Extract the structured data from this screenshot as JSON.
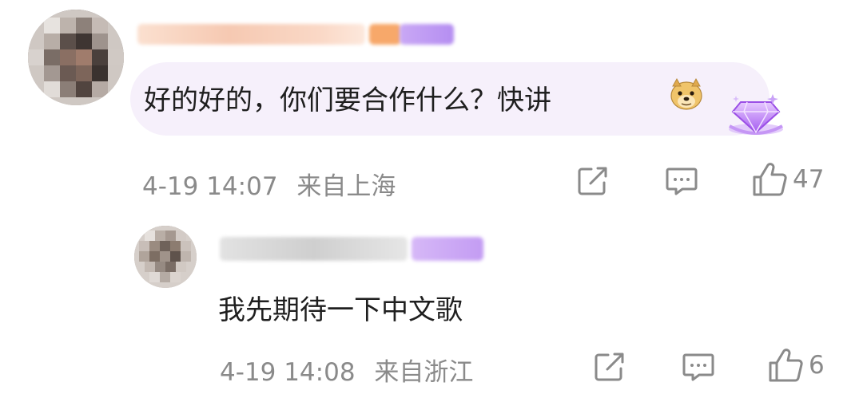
{
  "comments": [
    {
      "text": "好的好的，你们要合作什么？快讲",
      "emoji": "doge-emoji",
      "badge": "purple-diamond-badge",
      "time": "4-19 14:07",
      "location": "来自上海",
      "likes": "47"
    },
    {
      "text": "我先期待一下中文歌",
      "time": "4-19 14:08",
      "location": "来自浙江",
      "likes": "6"
    }
  ],
  "icons": {
    "share": "share-icon",
    "reply": "reply-icon",
    "like": "thumbs-up-icon"
  },
  "colors": {
    "bubble": "#f6f0fb",
    "meta_text": "#8a8a8a",
    "badge": "#b77cf2"
  }
}
